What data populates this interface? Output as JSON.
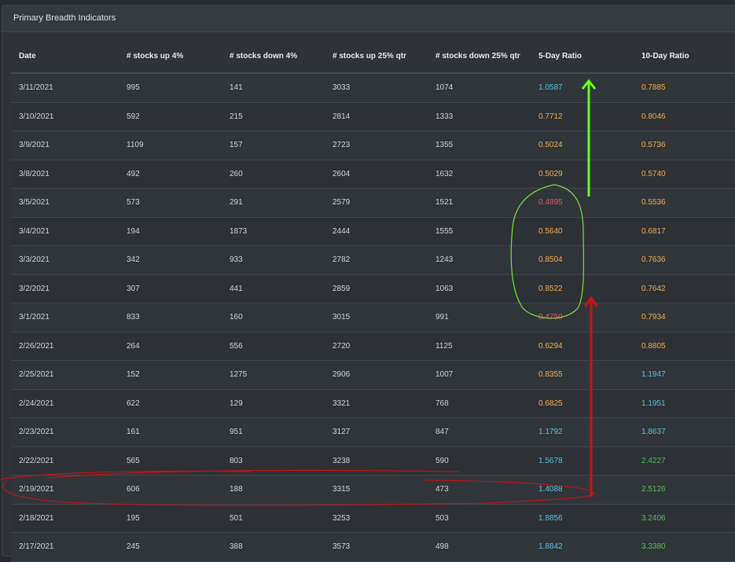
{
  "panel": {
    "title": "Primary Breadth Indicators"
  },
  "table": {
    "headers": [
      "Date",
      "# stocks up 4%",
      "# stocks down 4%",
      "# stocks up 25% qtr",
      "# stocks down 25% qtr",
      "5-Day Ratio",
      "10-Day Ratio"
    ],
    "rows": [
      {
        "date": "3/11/2021",
        "up4": "995",
        "down4": "141",
        "up25": "3033",
        "down25": "1074",
        "r5": "1.0587",
        "r5c": "blue",
        "r10": "0.7885",
        "r10c": "yellow"
      },
      {
        "date": "3/10/2021",
        "up4": "592",
        "down4": "215",
        "up25": "2814",
        "down25": "1333",
        "r5": "0.7712",
        "r5c": "yellow",
        "r10": "0.8046",
        "r10c": "yellow"
      },
      {
        "date": "3/9/2021",
        "up4": "1109",
        "down4": "157",
        "up25": "2723",
        "down25": "1355",
        "r5": "0.5024",
        "r5c": "yellow",
        "r10": "0.5736",
        "r10c": "yellow"
      },
      {
        "date": "3/8/2021",
        "up4": "492",
        "down4": "260",
        "up25": "2604",
        "down25": "1632",
        "r5": "0.5029",
        "r5c": "yellow",
        "r10": "0.5740",
        "r10c": "yellow"
      },
      {
        "date": "3/5/2021",
        "up4": "573",
        "down4": "291",
        "up25": "2579",
        "down25": "1521",
        "r5": "0.4895",
        "r5c": "red",
        "r10": "0.5536",
        "r10c": "yellow"
      },
      {
        "date": "3/4/2021",
        "up4": "194",
        "down4": "1873",
        "up25": "2444",
        "down25": "1555",
        "r5": "0.5640",
        "r5c": "yellow",
        "r10": "0.6817",
        "r10c": "yellow"
      },
      {
        "date": "3/3/2021",
        "up4": "342",
        "down4": "933",
        "up25": "2782",
        "down25": "1243",
        "r5": "0.8504",
        "r5c": "yellow",
        "r10": "0.7636",
        "r10c": "yellow"
      },
      {
        "date": "3/2/2021",
        "up4": "307",
        "down4": "441",
        "up25": "2859",
        "down25": "1063",
        "r5": "0.8522",
        "r5c": "yellow",
        "r10": "0.7642",
        "r10c": "yellow"
      },
      {
        "date": "3/1/2021",
        "up4": "833",
        "down4": "160",
        "up25": "3015",
        "down25": "991",
        "r5": "0.4750",
        "r5c": "red",
        "r10": "0.7934",
        "r10c": "yellow"
      },
      {
        "date": "2/26/2021",
        "up4": "264",
        "down4": "556",
        "up25": "2720",
        "down25": "1125",
        "r5": "0.6294",
        "r5c": "yellow",
        "r10": "0.8805",
        "r10c": "yellow"
      },
      {
        "date": "2/25/2021",
        "up4": "152",
        "down4": "1275",
        "up25": "2906",
        "down25": "1007",
        "r5": "0.8355",
        "r5c": "yellow",
        "r10": "1.1947",
        "r10c": "blue"
      },
      {
        "date": "2/24/2021",
        "up4": "622",
        "down4": "129",
        "up25": "3321",
        "down25": "768",
        "r5": "0.6825",
        "r5c": "yellow",
        "r10": "1.1951",
        "r10c": "blue"
      },
      {
        "date": "2/23/2021",
        "up4": "161",
        "down4": "951",
        "up25": "3127",
        "down25": "847",
        "r5": "1.1792",
        "r5c": "blue",
        "r10": "1.8637",
        "r10c": "blue"
      },
      {
        "date": "2/22/2021",
        "up4": "565",
        "down4": "803",
        "up25": "3238",
        "down25": "590",
        "r5": "1.5678",
        "r5c": "blue",
        "r10": "2.4227",
        "r10c": "green"
      },
      {
        "date": "2/19/2021",
        "up4": "606",
        "down4": "188",
        "up25": "3315",
        "down25": "473",
        "r5": "1.4088",
        "r5c": "blue",
        "r10": "2.5126",
        "r10c": "green"
      },
      {
        "date": "2/18/2021",
        "up4": "195",
        "down4": "501",
        "up25": "3253",
        "down25": "503",
        "r5": "1.8856",
        "r5c": "blue",
        "r10": "3.2406",
        "r10c": "green"
      },
      {
        "date": "2/17/2021",
        "up4": "245",
        "down4": "388",
        "up25": "3573",
        "down25": "498",
        "r5": "1.8842",
        "r5c": "blue",
        "r10": "3.3380",
        "r10c": "green"
      }
    ]
  },
  "colors": {
    "blue": "#5bc0de",
    "yellow": "#f0ad4e",
    "red": "#e8556a",
    "green": "#5cb85c",
    "annotation_green_arrow": "#66ff22",
    "annotation_red": "#cc1111",
    "annotation_circle": "#7ee23a"
  }
}
